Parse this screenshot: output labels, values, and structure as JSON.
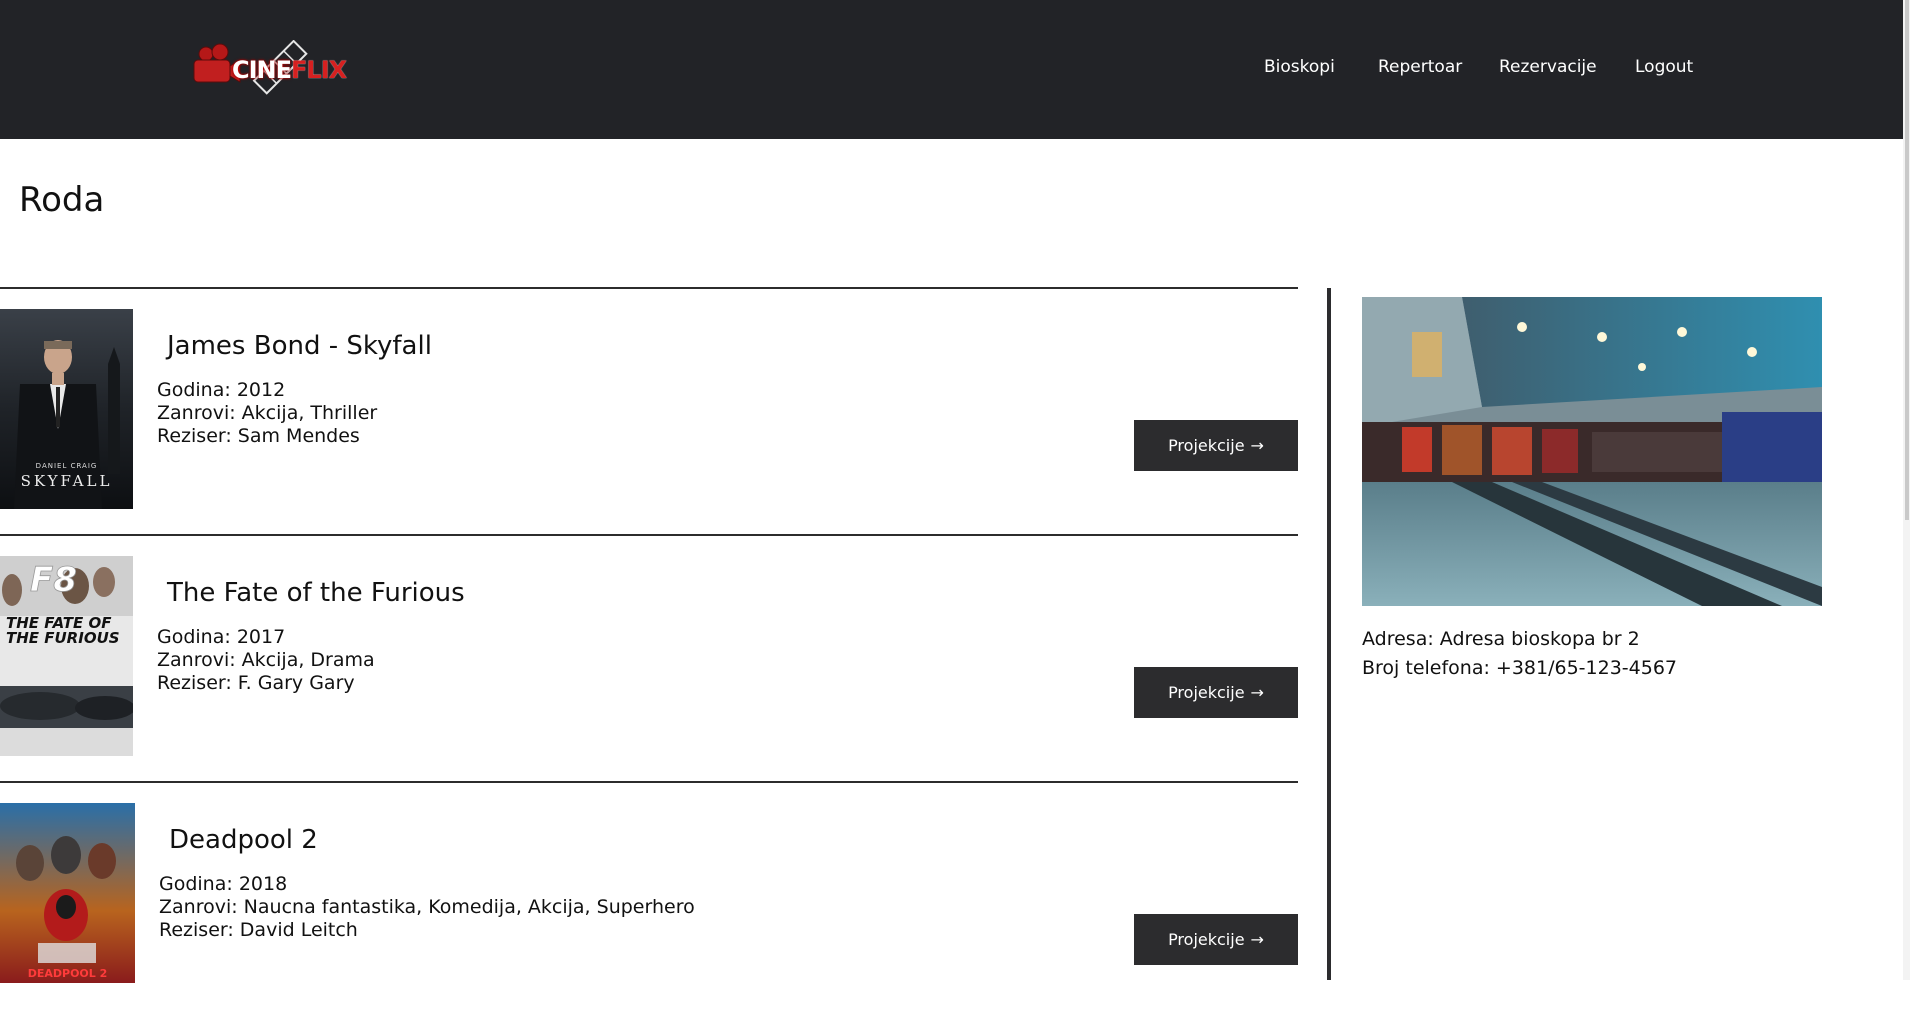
{
  "header": {
    "logo": {
      "word_main": "CINE",
      "word_accent": "FLIX"
    },
    "nav": [
      {
        "label": "Bioskopi"
      },
      {
        "label": "Repertoar"
      },
      {
        "label": "Rezervacije"
      },
      {
        "label": "Logout"
      }
    ]
  },
  "page": {
    "title": "Roda"
  },
  "movies": [
    {
      "title": "James Bond - Skyfall",
      "year": "Godina: 2012",
      "genres": "Zanrovi: Akcija, Thriller",
      "director": "Reziser: Sam Mendes",
      "button_label": "Projekcije",
      "poster_text": "SKYFALL",
      "poster_subtext": "DANIEL CRAIG"
    },
    {
      "title": "The Fate of the Furious",
      "year": "Godina: 2017",
      "genres": "Zanrovi: Akcija, Drama",
      "director": "Reziser: F. Gary Gary",
      "button_label": "Projekcije",
      "poster_text": "THE FATE OF THE FURIOUS",
      "poster_subtext": "F8"
    },
    {
      "title": "Deadpool 2",
      "year": "Godina: 2018",
      "genres": "Zanrovi: Naucna fantastika, Komedija, Akcija, Superhero",
      "director": "Reziser: David Leitch",
      "button_label": "Projekcije",
      "poster_text": "DEADPOOL 2",
      "poster_subtext": ""
    }
  ],
  "cinema": {
    "address": "Adresa: Adresa bioskopa br 2",
    "phone": "Broj telefona: +381/65-123-4567"
  },
  "icons": {
    "button_arrow": "arrow-right-icon"
  },
  "colors": {
    "navbar_bg": "#222327",
    "button_bg": "#2c2c2e",
    "logo_red": "#c91d1d"
  }
}
